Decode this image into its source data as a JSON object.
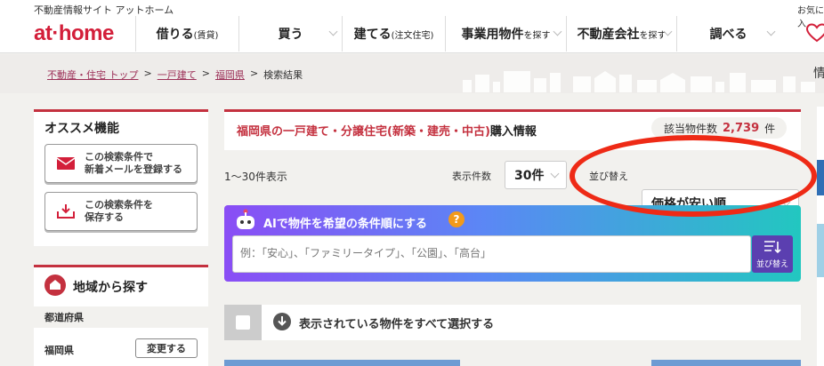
{
  "header": {
    "tagline": "不動産情報サイト アットホーム",
    "corner_text": "お気に入",
    "logo": "at·home",
    "nav": [
      {
        "label": "借りる",
        "sub": "(賃貸)"
      },
      {
        "label": "買う",
        "sub": ""
      },
      {
        "label": "建てる",
        "sub": "(注文住宅)"
      },
      {
        "label": "事業用物件",
        "sub": "を探す"
      },
      {
        "label": "不動産会社",
        "sub": "を探す"
      },
      {
        "label": "調べる",
        "sub": ""
      }
    ]
  },
  "breadcrumb": {
    "items": [
      "不動産・住宅 トップ",
      "一戸建て",
      "福岡県"
    ],
    "current": "検索結果",
    "separator": ">"
  },
  "side_tab": "情",
  "recommend": {
    "title": "オススメ機能",
    "register_button": [
      "この検索条件で",
      "新着メールを登録する"
    ],
    "save_button": [
      "この検索条件を",
      "保存する"
    ]
  },
  "region": {
    "title": "地域から探す",
    "prefecture_header": "都道府県",
    "prefecture_value": "福岡県",
    "change_button": "変更する"
  },
  "info": {
    "title_red": "福岡県の一戸建て・分譲住宅(新築・建売・中古)",
    "title_rest": "購入情報",
    "count_label": "該当物件数",
    "count_value": "2,739",
    "count_unit": "件"
  },
  "controls": {
    "range_text": "1〜30件表示",
    "per_page_label": "表示件数",
    "per_page_value": "30件",
    "sort_label": "並び替え",
    "sort_value": "価格が安い順"
  },
  "ai": {
    "title": "AIで物件を希望の条件順にする",
    "help": "?",
    "placeholder": "例：「安心」、「ファミリータイプ」、「公園」、「高台」",
    "sort_button": "並び替え"
  },
  "select_all": {
    "label": "表示されている物件をすべて選択する"
  },
  "colors": {
    "brand_red": "#d31f3a",
    "annotation_red": "#ee2a16",
    "ai_gradient_start": "#8a4df5",
    "ai_gradient_end": "#22c7c0"
  }
}
